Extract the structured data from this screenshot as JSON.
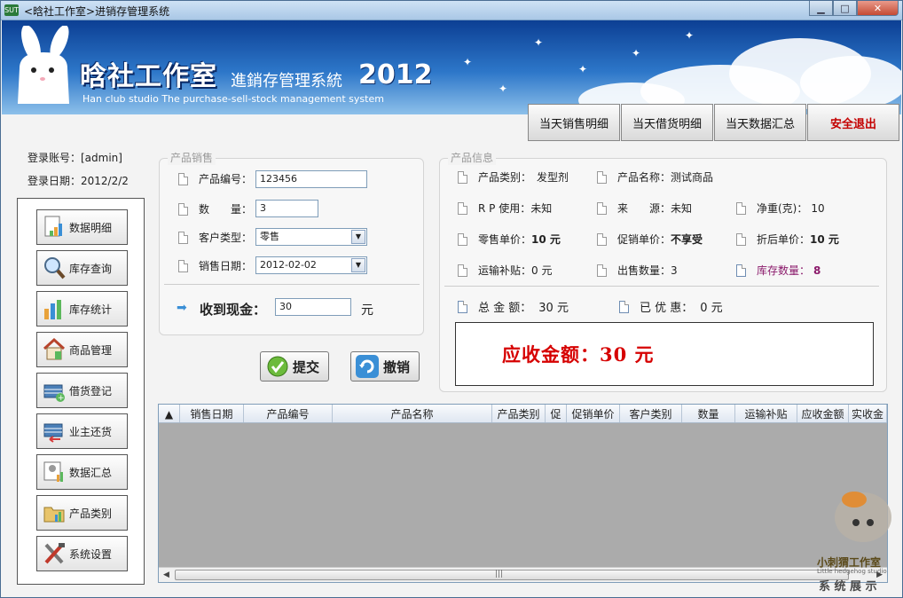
{
  "window": {
    "app_icon": "SUT",
    "title": "<晗社工作室>进销存管理系统"
  },
  "banner": {
    "logo_cn": "晗社工作室",
    "logo_sys": "進銷存管理系統",
    "logo_year": "2012",
    "logo_en": "Han club studio The purchase-sell-stock management system"
  },
  "top_buttons": [
    "当天销售明细",
    "当天借货明细",
    "当天数据汇总",
    "安全退出"
  ],
  "login": {
    "account": "登录账号：[admin]",
    "date": "登录日期：2012/2/2"
  },
  "sidebar": [
    "数据明细",
    "库存查询",
    "库存统计",
    "商品管理",
    "借货登记",
    "业主还货",
    "数据汇总",
    "产品类别",
    "系统设置"
  ],
  "sale": {
    "title": "产品销售",
    "code_label": "产品编号：",
    "code_value": "123456",
    "qty_label": "数　　量：",
    "qty_value": "3",
    "cust_label": "客户类型：",
    "cust_value": "零售",
    "date_label": "销售日期：",
    "date_value": "2012-02-02",
    "cash_label": "收到现金：",
    "cash_value": "30",
    "cash_unit": "元",
    "submit": "提交",
    "cancel": "撤销"
  },
  "info": {
    "title": "产品信息",
    "category_label": "产品类别：",
    "category_value": "发型剂",
    "name_label": "产品名称：",
    "name_value": "测试商品",
    "rp_label": "R P 使用：",
    "rp_value": "未知",
    "source_label": "来　　源：",
    "source_value": "未知",
    "weight_label": "净重(克)：",
    "weight_value": "10",
    "retail_label": "零售单价：",
    "retail_value": "10 元",
    "promo_label": "促销单价：",
    "promo_value": "不享受",
    "discount_label": "折后单价：",
    "discount_value": "10 元",
    "ship_label": "运输补贴：",
    "ship_value": "0 元",
    "sold_label": "出售数量：",
    "sold_value": "3",
    "stock_label": "库存数量：",
    "stock_value": "8",
    "total_label": "总 金 额：",
    "total_value": "30 元",
    "off_label": "已 优 惠：",
    "off_value": "0 元",
    "due_text": "应收金额：30 元"
  },
  "grid": {
    "headers": [
      "销售日期",
      "产品编号",
      "产品名称",
      "产品类别",
      "促",
      "促销单价",
      "客户类别",
      "数量",
      "运输补贴",
      "应收金额",
      "实收金"
    ],
    "scroll_grip": "|||"
  },
  "watermark": {
    "line1": "小刺猬工作室",
    "line2": "Little hedgehog studio",
    "line3": "系 统 展 示"
  },
  "colors": {
    "exit": "#c40000",
    "due": "#d60000",
    "stock": "#8b1a6b"
  }
}
